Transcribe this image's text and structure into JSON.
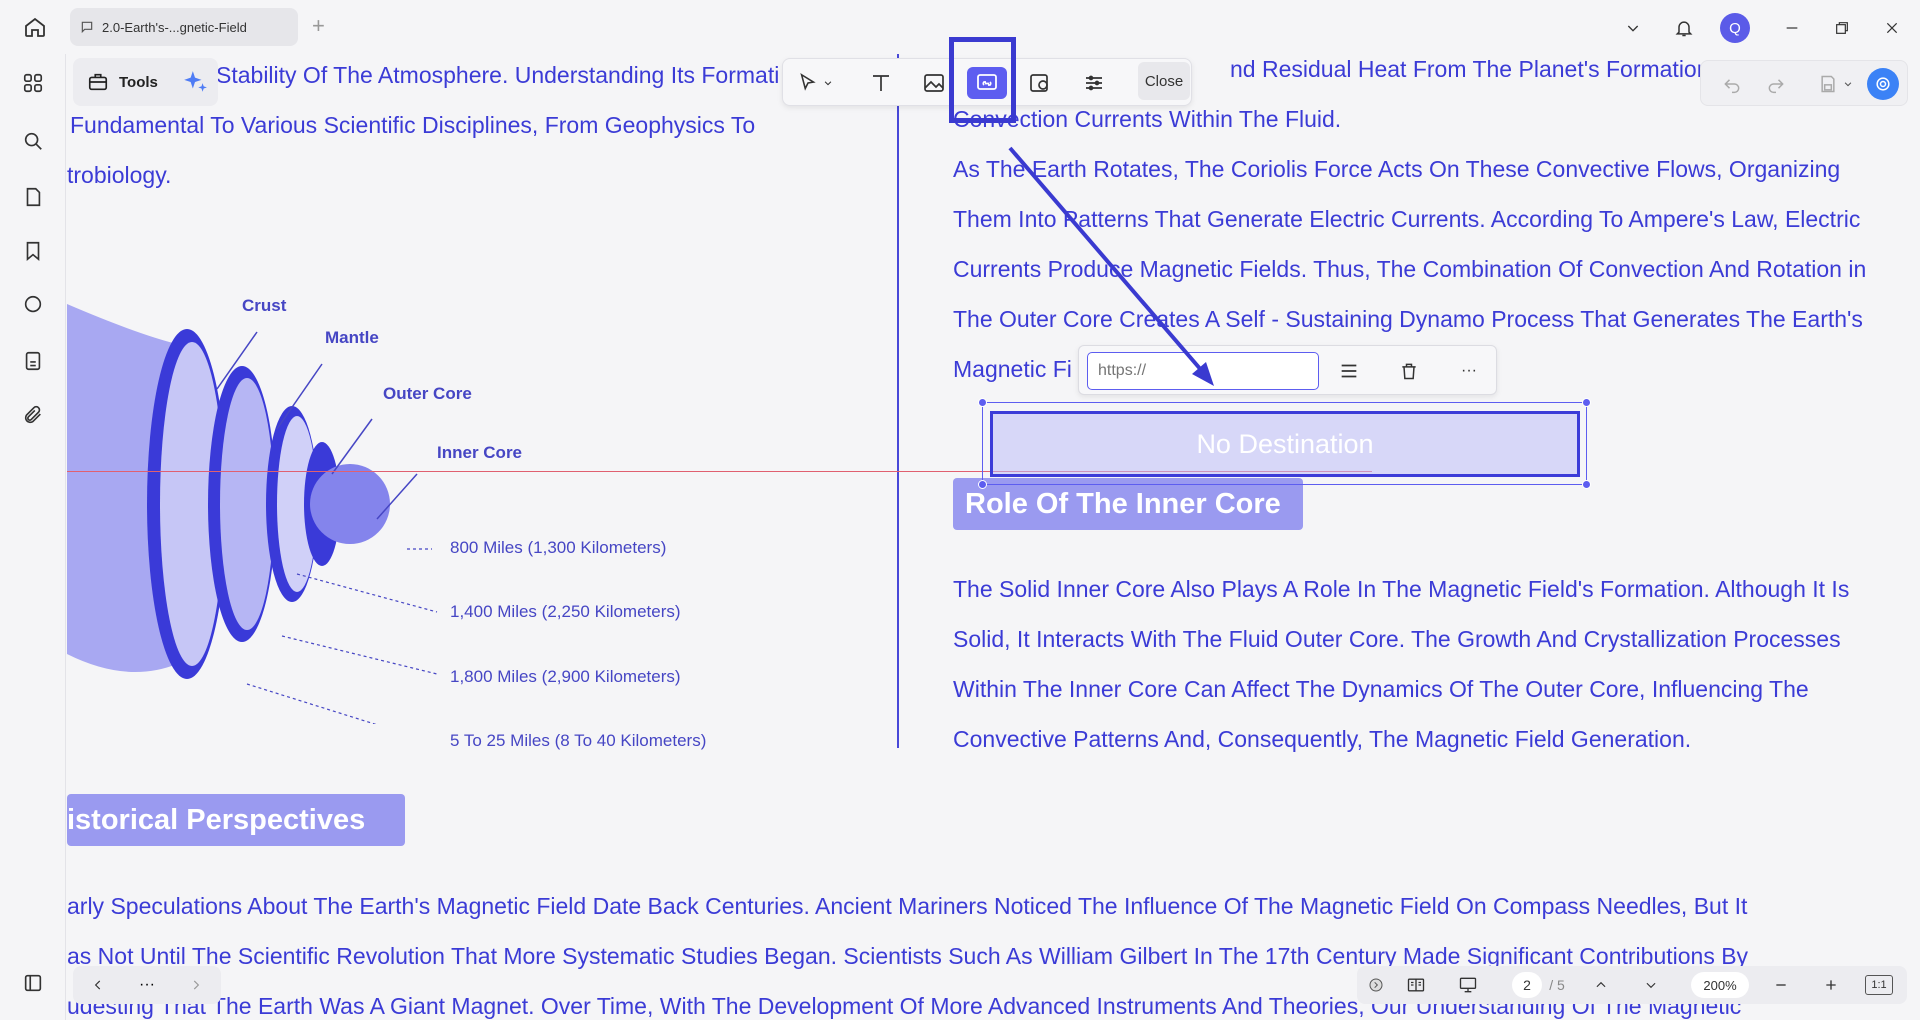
{
  "titlebar": {
    "tab_title": "2.0-Earth's-...gnetic-Field",
    "add_tab": "+",
    "avatar_letter": "Q"
  },
  "toolbar": {
    "tools_label": "Tools",
    "close_label": "Close"
  },
  "document": {
    "left_column": [
      "Stability Of The Atmosphere. Understanding Its Formati",
      "Fundamental To Various Scientific Disciplines, From Geophysics To",
      "trobiology."
    ],
    "right_column_top": [
      "nd Residual Heat From The Planet's Formation.",
      "Convection Currents Within The Fluid.",
      "As The Earth Rotates, The Coriolis Force Acts On These Convective Flows, Organizing",
      "Them Into Patterns That Generate Electric Currents. According To Ampere's Law, Electric",
      "Currents Produce Magnetic Fields. Thus, The Combination Of Convection And Rotation in",
      "The Outer Core Creates A Self - Sustaining Dynamo Process That Generates The Earth's",
      "Magnetic Fi"
    ],
    "inner_core_heading": "Role Of The Inner Core",
    "inner_core_paragraph": [
      "The Solid Inner Core Also Plays A Role In The Magnetic Field's Formation. Although It Is",
      "Solid, It Interacts With The Fluid Outer Core. The Growth And Crystallization Processes",
      "Within The Inner Core Can Affect The Dynamics Of The Outer Core, Influencing The",
      "Convective Patterns And, Consequently, The Magnetic Field Generation."
    ],
    "historical_heading": "istorical Perspectives",
    "historical_paragraph": [
      "arly Speculations About The Earth's Magnetic Field Date Back Centuries. Ancient Mariners Noticed The Influence Of The Magnetic Field On Compass Needles, But It",
      "as Not Until The Scientific Revolution That More Systematic Studies Began. Scientists Such As William Gilbert In The 17th Century Made Significant Contributions By",
      "udesting That The Earth Was A Giant Magnet. Over Time, With The Development Of More Advanced Instruments And Theories, Our Understanding Of The Magnetic"
    ],
    "diagram": {
      "labels": [
        "Crust",
        "Mantle",
        "Outer Core",
        "Inner Core"
      ],
      "measures": [
        "800 Miles (1,300 Kilometers)",
        "1,400 Miles (2,250 Kilometers)",
        "1,800 Miles (2,900 Kilometers)",
        "5 To 25 Miles (8 To 40 Kilometers)"
      ]
    }
  },
  "link_popup": {
    "url_placeholder": "https://",
    "more_label": "···"
  },
  "link_annotation": {
    "label": "No Destination"
  },
  "bottombar": {
    "more_label": "···",
    "current_page": "2",
    "total_pages": "/ 5",
    "zoom": "200%",
    "fit_label": "1:1"
  },
  "colors": {
    "accent": "#5d5df0",
    "text_blue": "#3b3bd6",
    "heading_bg": "#9a9af0"
  }
}
